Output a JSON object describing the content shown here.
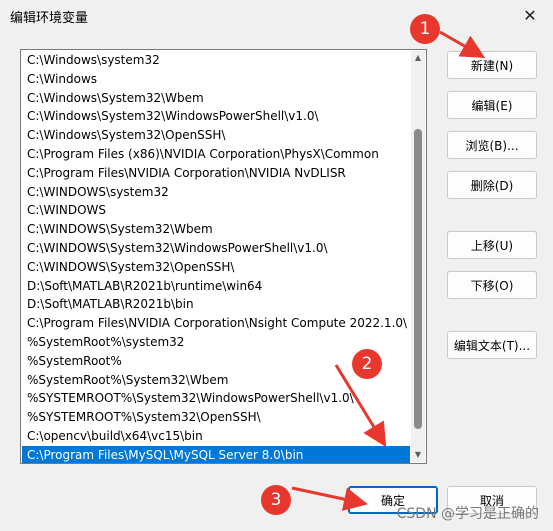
{
  "window": {
    "title": "编辑环境变量",
    "close_glyph": "✕"
  },
  "paths": [
    "C:\\Windows\\system32",
    "C:\\Windows",
    "C:\\Windows\\System32\\Wbem",
    "C:\\Windows\\System32\\WindowsPowerShell\\v1.0\\",
    "C:\\Windows\\System32\\OpenSSH\\",
    "C:\\Program Files (x86)\\NVIDIA Corporation\\PhysX\\Common",
    "C:\\Program Files\\NVIDIA Corporation\\NVIDIA NvDLISR",
    "C:\\WINDOWS\\system32",
    "C:\\WINDOWS",
    "C:\\WINDOWS\\System32\\Wbem",
    "C:\\WINDOWS\\System32\\WindowsPowerShell\\v1.0\\",
    "C:\\WINDOWS\\System32\\OpenSSH\\",
    "D:\\Soft\\MATLAB\\R2021b\\runtime\\win64",
    "D:\\Soft\\MATLAB\\R2021b\\bin",
    "C:\\Program Files\\NVIDIA Corporation\\Nsight Compute 2022.1.0\\",
    "%SystemRoot%\\system32",
    "%SystemRoot%",
    "%SystemRoot%\\System32\\Wbem",
    "%SYSTEMROOT%\\System32\\WindowsPowerShell\\v1.0\\",
    "%SYSTEMROOT%\\System32\\OpenSSH\\",
    "C:\\opencv\\build\\x64\\vc15\\bin",
    "C:\\Program Files\\MySQL\\MySQL Server 8.0\\bin"
  ],
  "selected_index": 21,
  "buttons": {
    "new": "新建(N)",
    "edit": "编辑(E)",
    "browse": "浏览(B)...",
    "delete": "删除(D)",
    "move_up": "上移(U)",
    "move_down": "下移(O)",
    "edit_text": "编辑文本(T)...",
    "ok": "确定",
    "cancel": "取消"
  },
  "annotations": {
    "one": "1",
    "two": "2",
    "three": "3"
  },
  "watermark": "CSDN @学习是正确的",
  "colors": {
    "selection": "#0078d7",
    "annotation": "#e8372c"
  }
}
